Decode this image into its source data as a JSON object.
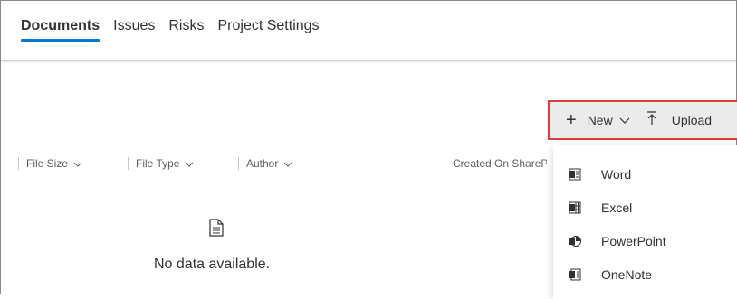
{
  "tabs": [
    {
      "label": "Documents",
      "active": true
    },
    {
      "label": "Issues",
      "active": false
    },
    {
      "label": "Risks",
      "active": false
    },
    {
      "label": "Project Settings",
      "active": false
    }
  ],
  "commands": {
    "new_label": "New",
    "upload_label": "Upload"
  },
  "columns": [
    {
      "label": "File Size"
    },
    {
      "label": "File Type"
    },
    {
      "label": "Author"
    },
    {
      "label": "Created On SharePoint"
    }
  ],
  "empty_state": {
    "text": "No data available."
  },
  "new_menu": {
    "items": [
      {
        "label": "Word",
        "icon": "word-icon"
      },
      {
        "label": "Excel",
        "icon": "excel-icon"
      },
      {
        "label": "PowerPoint",
        "icon": "powerpoint-icon"
      },
      {
        "label": "OneNote",
        "icon": "onenote-icon"
      }
    ]
  },
  "colors": {
    "accent": "#0078d4",
    "highlight_border": "#e03c3c"
  }
}
